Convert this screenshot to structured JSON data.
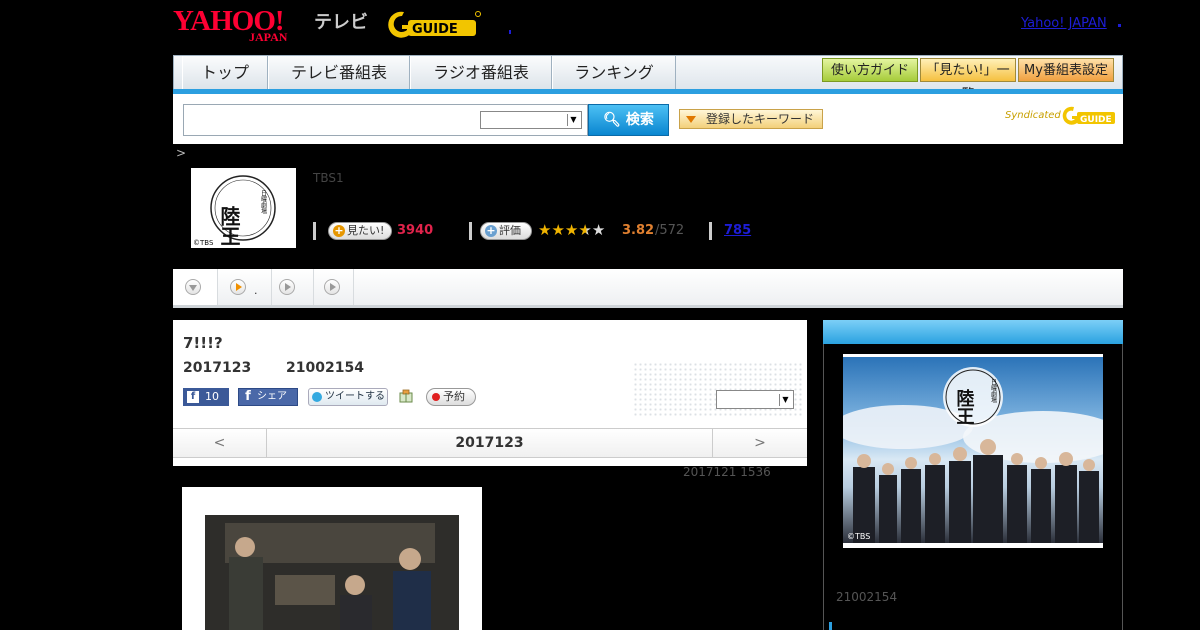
{
  "header": {
    "yahoo_logo_main": "YAHOO!",
    "yahoo_logo_sub": "JAPAN",
    "tv_label": "テレビ",
    "gguide_logo": "GUIDE",
    "yahoo_japan_link": "Yahoo! JAPAN"
  },
  "nav": {
    "tabs": [
      {
        "label": "トップ"
      },
      {
        "label": "テレビ番組表"
      },
      {
        "label": "ラジオ番組表"
      },
      {
        "label": "ランキング"
      }
    ],
    "guide_label": "使い方ガイド",
    "wish_list_label": "「見たい!」一覧",
    "my_table_label": "My番組表設定"
  },
  "search": {
    "input_value": "",
    "select_value": "",
    "button_label": "検索",
    "keyword_button_label": "登録したキーワード",
    "syndicated_label": "Syndicated",
    "syndicated_logo": "GUIDE"
  },
  "breadcrumb": {
    "sep": ">"
  },
  "program": {
    "channel": "TBS1",
    "logo_title": "陸王",
    "logo_sub": "日曜劇場",
    "logo_credit": "©TBS",
    "wish_label": "見たい!",
    "wish_count": "3940",
    "rate_label": "評価",
    "rating": {
      "score": "3.82",
      "total": "/572",
      "stars_value": 3.82,
      "stars_max": 5
    },
    "comment_count": "785"
  },
  "tabs_bar": {
    "dot_text": "."
  },
  "episode": {
    "title": "7!!!?",
    "date": "2017123",
    "time": "21002154",
    "fb_count": "10",
    "fb_share_label": "シェア",
    "tweet_label": "ツイートする",
    "reserve_label": "予約",
    "select_value": "",
    "pager_prev": "<",
    "pager_date": "2017123",
    "pager_next": ">",
    "updated": "2017121  1536"
  },
  "side": {
    "image_credit": "©TBS",
    "image_title": "陸王",
    "image_sub": "日曜劇場",
    "time": "21002154"
  },
  "colors": {
    "accent_blue": "#2c9fe0",
    "wish_red": "#e0234b",
    "rating_orange": "#e08030",
    "link_blue": "#1d1dd6"
  }
}
